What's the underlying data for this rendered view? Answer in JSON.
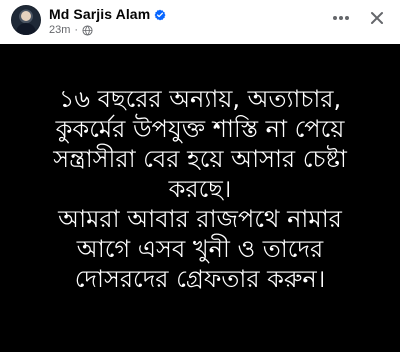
{
  "header": {
    "author_name": "Md Sarjis Alam",
    "timestamp": "23m",
    "separator": "·",
    "audience_icon": "globe-icon",
    "verified_icon": "verified-badge-icon",
    "more_icon": "more-horizontal-icon",
    "close_icon": "close-icon"
  },
  "post": {
    "text": "১৬ বছরের অন্যায়, অত্যাচার,\nকুকর্মের উপযুক্ত শাস্তি না পেয়ে\nসন্ত্রাসীরা বের হয়ে আসার চেষ্টা\nকরছে।\nআমরা আবার রাজপথে নামার\nআগে এসব খুনী ও তাদের\nদোসরদের গ্রেফতার করুন।",
    "background_color": "#000000",
    "text_color": "#ffffff"
  },
  "colors": {
    "verified_blue": "#0866ff",
    "meta_gray": "#65676b",
    "name_black": "#050505"
  }
}
